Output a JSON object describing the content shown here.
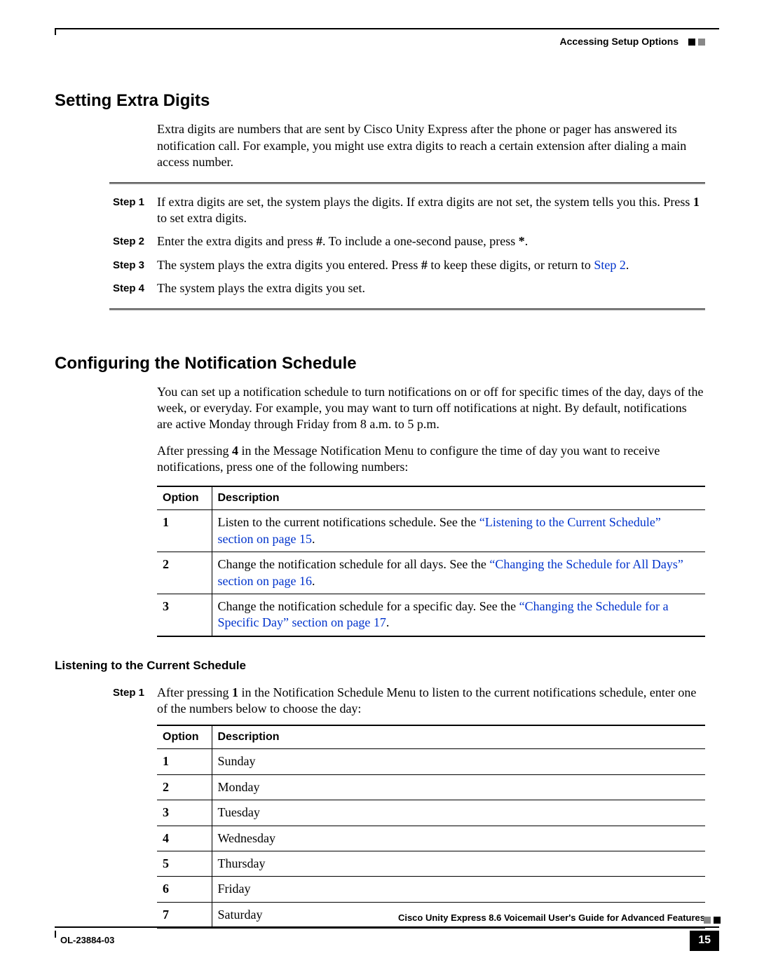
{
  "header": {
    "breadcrumb": "Accessing Setup Options"
  },
  "section1": {
    "title": "Setting Extra Digits",
    "intro": "Extra digits are numbers that are sent by Cisco Unity Express after the phone or pager has answered its notification call. For example, you might use extra digits to reach a certain extension after dialing a main access number.",
    "steps": [
      {
        "label": "Step 1",
        "html": "If extra digits are set, the system plays the digits. If extra digits are not set, the system tells you this. Press <b class='serif'>1</b> to set extra digits."
      },
      {
        "label": "Step 2",
        "html": "Enter the extra digits and press <b class='serif'>#</b>. To include a one-second pause, press <b class='serif'>*</b>."
      },
      {
        "label": "Step 3",
        "html": "The system plays the extra digits you entered. Press <b class='serif'>#</b> to keep these digits, or return to <span class='link'>Step 2</span>."
      },
      {
        "label": "Step 4",
        "html": "The system plays the extra digits you set."
      }
    ]
  },
  "section2": {
    "title": "Configuring the Notification Schedule",
    "p1": "You can set up a notification schedule to turn notifications on or off for specific times of the day, days of the week, or everyday. For example, you may want to turn off notifications at night. By default, notifications are active Monday through Friday from 8 a.m. to 5 p.m.",
    "p2_html": "After pressing <b class='serif'>4</b> in the Message Notification Menu to configure the time of day you want to receive notifications, press one of the following numbers:",
    "table_headers": {
      "c1": "Option",
      "c2": "Description"
    },
    "table_rows": [
      {
        "opt": "1",
        "desc_html": "Listen to the current notifications schedule. See the <span class='link'>&ldquo;Listening to the Current Schedule&rdquo; section on page 15</span>."
      },
      {
        "opt": "2",
        "desc_html": "Change the notification schedule for all days. See the <span class='link'>&ldquo;Changing the Schedule for All Days&rdquo; section on page 16</span>."
      },
      {
        "opt": "3",
        "desc_html": "Change the notification schedule for a specific day. See the <span class='link'>&ldquo;Changing the Schedule for a Specific Day&rdquo; section on page 17</span>."
      }
    ],
    "sub": {
      "title": "Listening to the Current Schedule",
      "step_label": "Step 1",
      "step_html": "After pressing <b class='serif'>1</b> in the Notification Schedule Menu to listen to the current notifications schedule, enter one of the numbers below to choose the day:",
      "days_headers": {
        "c1": "Option",
        "c2": "Description"
      },
      "days": [
        {
          "opt": "1",
          "day": "Sunday"
        },
        {
          "opt": "2",
          "day": "Monday"
        },
        {
          "opt": "3",
          "day": "Tuesday"
        },
        {
          "opt": "4",
          "day": "Wednesday"
        },
        {
          "opt": "5",
          "day": "Thursday"
        },
        {
          "opt": "6",
          "day": "Friday"
        },
        {
          "opt": "7",
          "day": "Saturday"
        }
      ]
    }
  },
  "footer": {
    "doc_title": "Cisco Unity Express 8.6 Voicemail User's Guide for Advanced Features",
    "doc_id": "OL-23884-03",
    "page": "15"
  }
}
